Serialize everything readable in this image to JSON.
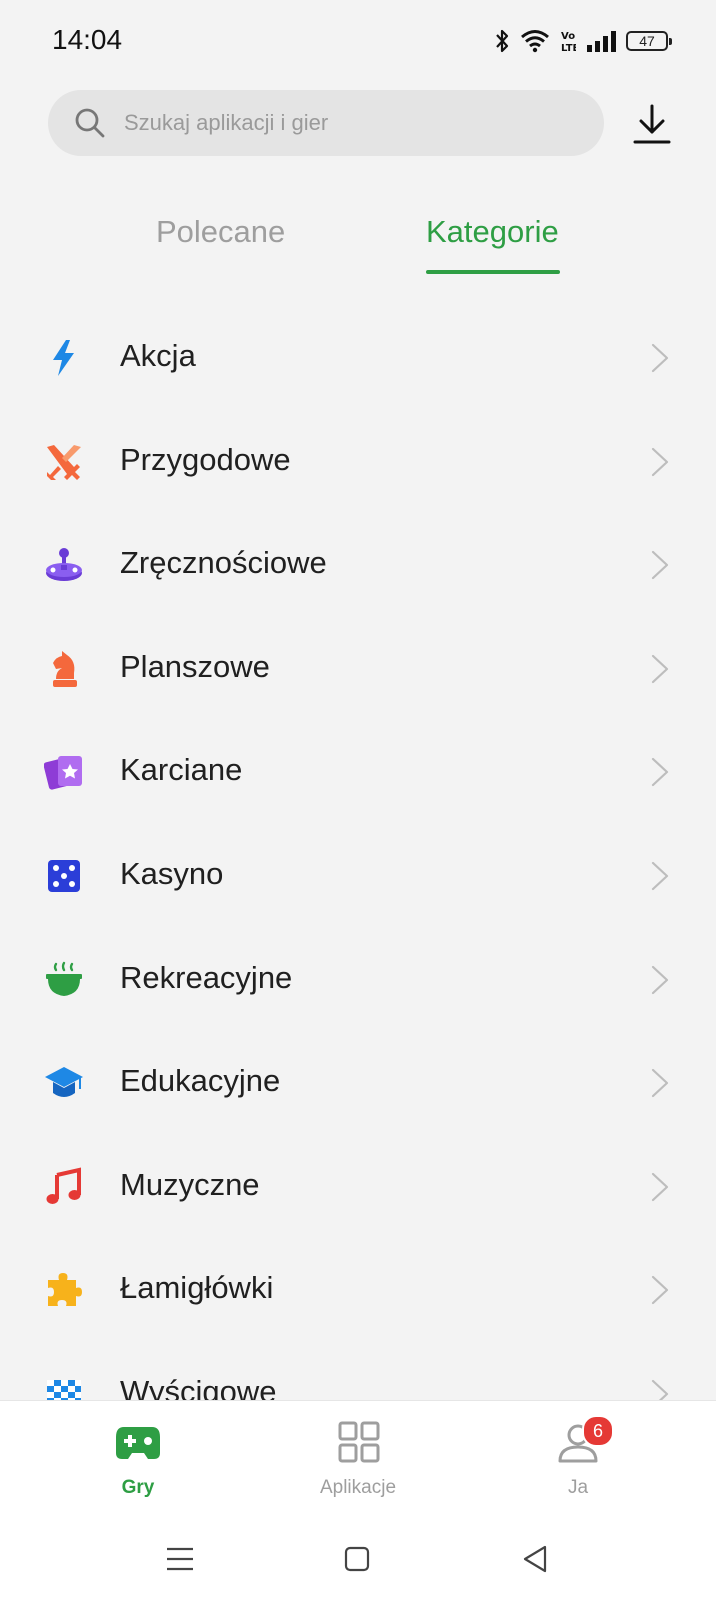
{
  "status_bar": {
    "time": "14:04",
    "battery_level": "47",
    "network_label": "Vo LTE"
  },
  "search": {
    "placeholder": "Szukaj aplikacji i gier",
    "value": ""
  },
  "tabs": [
    {
      "label": "Polecane",
      "active": false
    },
    {
      "label": "Kategorie",
      "active": true
    }
  ],
  "colors": {
    "accent": "#2e9e44",
    "background": "#f3f3f3",
    "badge": "#e53935"
  },
  "categories": [
    {
      "label": "Akcja",
      "icon": "lightning-icon",
      "color": "#1e88e5"
    },
    {
      "label": "Przygodowe",
      "icon": "crossed-swords-icon",
      "color": "#f4683c"
    },
    {
      "label": "Zręcznościowe",
      "icon": "joystick-icon",
      "color": "#6a3cd6"
    },
    {
      "label": "Planszowe",
      "icon": "chess-knight-icon",
      "color": "#f4683c"
    },
    {
      "label": "Karciane",
      "icon": "cards-icon",
      "color": "#8e3cd6"
    },
    {
      "label": "Kasyno",
      "icon": "dice-icon",
      "color": "#2b3ed8"
    },
    {
      "label": "Rekreacyjne",
      "icon": "tea-bowl-icon",
      "color": "#2e9e44"
    },
    {
      "label": "Edukacyjne",
      "icon": "graduation-cap-icon",
      "color": "#1e88e5"
    },
    {
      "label": "Muzyczne",
      "icon": "music-note-icon",
      "color": "#e53935"
    },
    {
      "label": "Łamigłówki",
      "icon": "puzzle-icon",
      "color": "#f7b21b"
    },
    {
      "label": "Wyścigowe",
      "icon": "checkered-flag-icon",
      "color": "#1e88e5"
    }
  ],
  "bottom_nav": {
    "games_label": "Gry",
    "apps_label": "Aplikacje",
    "me_label": "Ja",
    "me_badge": "6"
  }
}
